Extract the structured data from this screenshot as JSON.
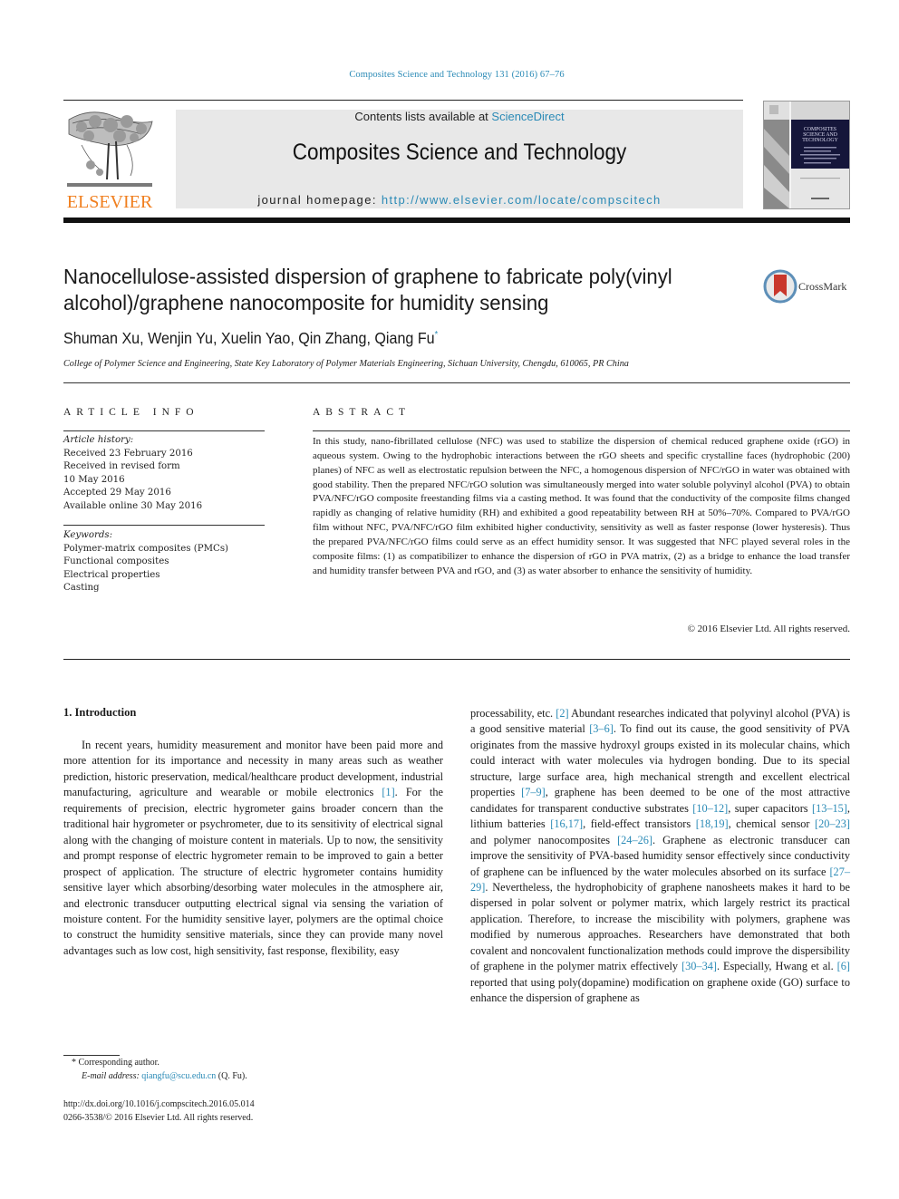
{
  "header": {
    "journal_ref": "Composites Science and Technology 131 (2016) 67–76",
    "contents_prefix": "Contents lists available at ",
    "contents_link": "ScienceDirect",
    "journal_title": "Composites Science and Technology",
    "homepage_prefix": "journal homepage: ",
    "homepage_url": "http://www.elsevier.com/locate/compscitech",
    "publisher_logo_text": "ELSEVIER",
    "cover_title_lines": [
      "COMPOSITES",
      "SCIENCE AND",
      "TECHNOLOGY"
    ],
    "brand_color": "#f07f1f",
    "link_color": "#2a8ab6"
  },
  "article": {
    "title": "Nanocellulose-assisted dispersion of graphene to fabricate poly(vinyl alcohol)/graphene nanocomposite for humidity sensing",
    "crossmark_label": "CrossMark",
    "authors": "Shuman Xu, Wenjin Yu, Xuelin Yao, Qin Zhang, Qiang Fu",
    "corresponding_marker": "*",
    "affiliation": "College of Polymer Science and Engineering, State Key Laboratory of Polymer Materials Engineering, Sichuan University, Chengdu, 610065, PR China"
  },
  "article_info": {
    "heading": "ARTICLE INFO",
    "history_label": "Article history:",
    "history": [
      "Received 23 February 2016",
      "Received in revised form",
      "10 May 2016",
      "Accepted 29 May 2016",
      "Available online 30 May 2016"
    ],
    "keywords_label": "Keywords:",
    "keywords": [
      "Polymer-matrix composites (PMCs)",
      "Functional composites",
      "Electrical properties",
      "Casting"
    ]
  },
  "abstract": {
    "heading": "ABSTRACT",
    "text": "In this study, nano-fibrillated cellulose (NFC) was used to stabilize the dispersion of chemical reduced graphene oxide (rGO) in aqueous system. Owing to the hydrophobic interactions between the rGO sheets and specific crystalline faces (hydrophobic (200) planes) of NFC as well as electrostatic repulsion between the NFC, a homogenous dispersion of NFC/rGO in water was obtained with good stability. Then the prepared NFC/rGO solution was simultaneously merged into water soluble polyvinyl alcohol (PVA) to obtain PVA/NFC/rGO composite freestanding films via a casting method. It was found that the conductivity of the composite films changed rapidly as changing of relative humidity (RH) and exhibited a good repeatability between RH at 50%–70%. Compared to PVA/rGO film without NFC, PVA/NFC/rGO film exhibited higher conductivity, sensitivity as well as faster response (lower hysteresis). Thus the prepared PVA/NFC/rGO films could serve as an effect humidity sensor. It was suggested that NFC played several roles in the composite films: (1) as compatibilizer to enhance the dispersion of rGO in PVA matrix, (2) as a bridge to enhance the load transfer and humidity transfer between PVA and rGO, and (3) as water absorber to enhance the sensitivity of humidity.",
    "copyright": "© 2016 Elsevier Ltd. All rights reserved."
  },
  "body": {
    "section_heading": "1.  Introduction",
    "left_column": [
      {
        "t": "In recent years, humidity measurement and monitor have been paid more and more attention for its importance and necessity in many areas such as weather prediction, historic preservation, medical/healthcare product development, industrial manufacturing, agriculture and wearable or mobile electronics "
      },
      {
        "ref": "[1]"
      },
      {
        "t": ". For the requirements of precision, electric hygrometer gains broader concern than the traditional hair hygrometer or psychrometer, due to its sensitivity of electrical signal along with the changing of moisture content in materials. Up to now, the sensitivity and prompt response of electric hygrometer remain to be improved to gain a better prospect of application. The structure of electric hygrometer contains humidity sensitive layer which absorbing/desorbing water molecules in the atmosphere air, and electronic transducer outputting electrical signal via sensing the variation of moisture content. For the humidity sensitive layer, polymers are the optimal choice to construct the humidity sensitive materials, since they can provide many novel advantages such as low cost, high sensitivity, fast response, flexibility, easy"
      }
    ],
    "right_column": [
      {
        "t": "processability, etc. "
      },
      {
        "ref": "[2]"
      },
      {
        "t": " Abundant researches indicated that polyvinyl alcohol (PVA) is a good sensitive material "
      },
      {
        "ref": "[3–6]"
      },
      {
        "t": ". To find out its cause, the good sensitivity of PVA originates from the massive hydroxyl groups existed in its molecular chains, which could interact with water molecules via hydrogen bonding. Due to its special structure, large surface area, high mechanical strength and excellent electrical properties "
      },
      {
        "ref": "[7–9]"
      },
      {
        "t": ", graphene has been deemed to be one of the most attractive candidates for transparent conductive substrates "
      },
      {
        "ref": "[10–12]"
      },
      {
        "t": ", super capacitors "
      },
      {
        "ref": "[13–15]"
      },
      {
        "t": ", lithium batteries "
      },
      {
        "ref": "[16,17]"
      },
      {
        "t": ", field-effect transistors "
      },
      {
        "ref": "[18,19]"
      },
      {
        "t": ", chemical sensor "
      },
      {
        "ref": "[20–23]"
      },
      {
        "t": " and polymer nanocomposites "
      },
      {
        "ref": "[24–26]"
      },
      {
        "t": ". Graphene as electronic transducer can improve the sensitivity of PVA-based humidity sensor effectively since conductivity of graphene can be influenced by the water molecules absorbed on its surface "
      },
      {
        "ref": "[27–29]"
      },
      {
        "t": ". Nevertheless, the hydrophobicity of graphene nanosheets makes it hard to be dispersed in polar solvent or polymer matrix, which largely restrict its practical application. Therefore, to increase the miscibility with polymers, graphene was modified by numerous approaches. Researchers have demonstrated that both covalent and noncovalent functionalization methods could improve the dispersibility of graphene in the polymer matrix effectively "
      },
      {
        "ref": "[30–34]"
      },
      {
        "t": ". Especially, Hwang et al. "
      },
      {
        "ref": "[6]"
      },
      {
        "t": " reported that using poly(dopamine) modification on graphene oxide (GO) surface to enhance the dispersion of graphene as"
      }
    ]
  },
  "footnotes": {
    "corresponding": "* Corresponding author.",
    "email_label": "E-mail address: ",
    "email": "qiangfu@scu.edu.cn",
    "email_suffix": " (Q. Fu).",
    "doi": "http://dx.doi.org/10.1016/j.compscitech.2016.05.014",
    "issn": "0266-3538/© 2016 Elsevier Ltd. All rights reserved."
  }
}
